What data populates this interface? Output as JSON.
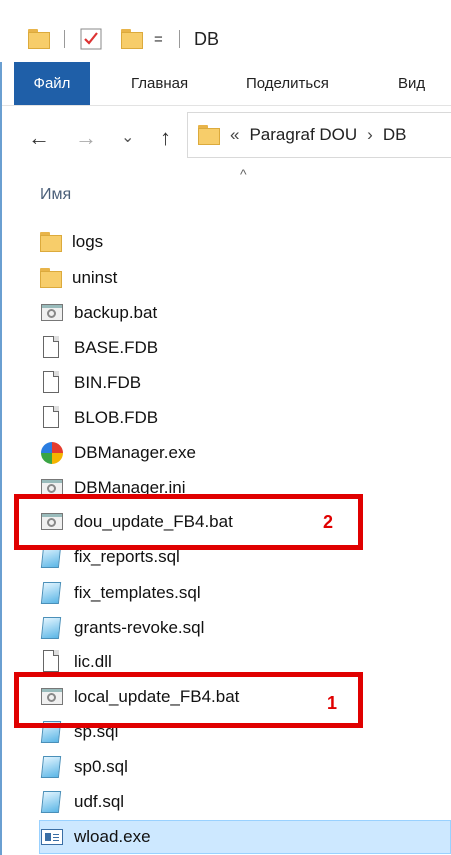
{
  "window": {
    "title": "DB",
    "qa_sep": "|",
    "qa_dropdown": "="
  },
  "ribbon": {
    "tabs": [
      "Файл",
      "Главная",
      "Поделиться",
      "Вид"
    ]
  },
  "nav": {
    "back": "←",
    "forward": "→",
    "recent": "⌄",
    "up": "↑"
  },
  "address": {
    "overflow": "«",
    "segments": [
      "Paragraf DOU",
      "DB"
    ],
    "separator": "›"
  },
  "list_header": {
    "name": "Имя",
    "sort_indicator": "^"
  },
  "files": [
    {
      "name": "logs",
      "icon": "folder-icon"
    },
    {
      "name": "uninst",
      "icon": "folder-icon"
    },
    {
      "name": "backup.bat",
      "icon": "batch-file-icon"
    },
    {
      "name": "BASE.FDB",
      "icon": "file-icon"
    },
    {
      "name": "BIN.FDB",
      "icon": "file-icon"
    },
    {
      "name": "BLOB.FDB",
      "icon": "file-icon"
    },
    {
      "name": "DBManager.exe",
      "icon": "dbmanager-app-icon"
    },
    {
      "name": "DBManager.ini",
      "icon": "ini-file-icon"
    },
    {
      "name": "dou_update_FB4.bat",
      "icon": "batch-file-icon"
    },
    {
      "name": "fix_reports.sql",
      "icon": "sql-file-icon"
    },
    {
      "name": "fix_templates.sql",
      "icon": "sql-file-icon"
    },
    {
      "name": "grants-revoke.sql",
      "icon": "sql-file-icon"
    },
    {
      "name": "lic.dll",
      "icon": "dll-file-icon"
    },
    {
      "name": "local_update_FB4.bat",
      "icon": "batch-file-icon"
    },
    {
      "name": "sp.sql",
      "icon": "sql-file-icon"
    },
    {
      "name": "sp0.sql",
      "icon": "sql-file-icon"
    },
    {
      "name": "udf.sql",
      "icon": "sql-file-icon"
    },
    {
      "name": "wload.exe",
      "icon": "exe-window-icon"
    }
  ],
  "annotations": [
    {
      "label": "2",
      "target": "dou_update_FB4.bat"
    },
    {
      "label": "1",
      "target": "local_update_FB4.bat"
    }
  ],
  "colors": {
    "file_tab": "#1f5fa8",
    "highlight": "#e00000",
    "selection": "#cde8ff",
    "header_text": "#4c607a"
  }
}
